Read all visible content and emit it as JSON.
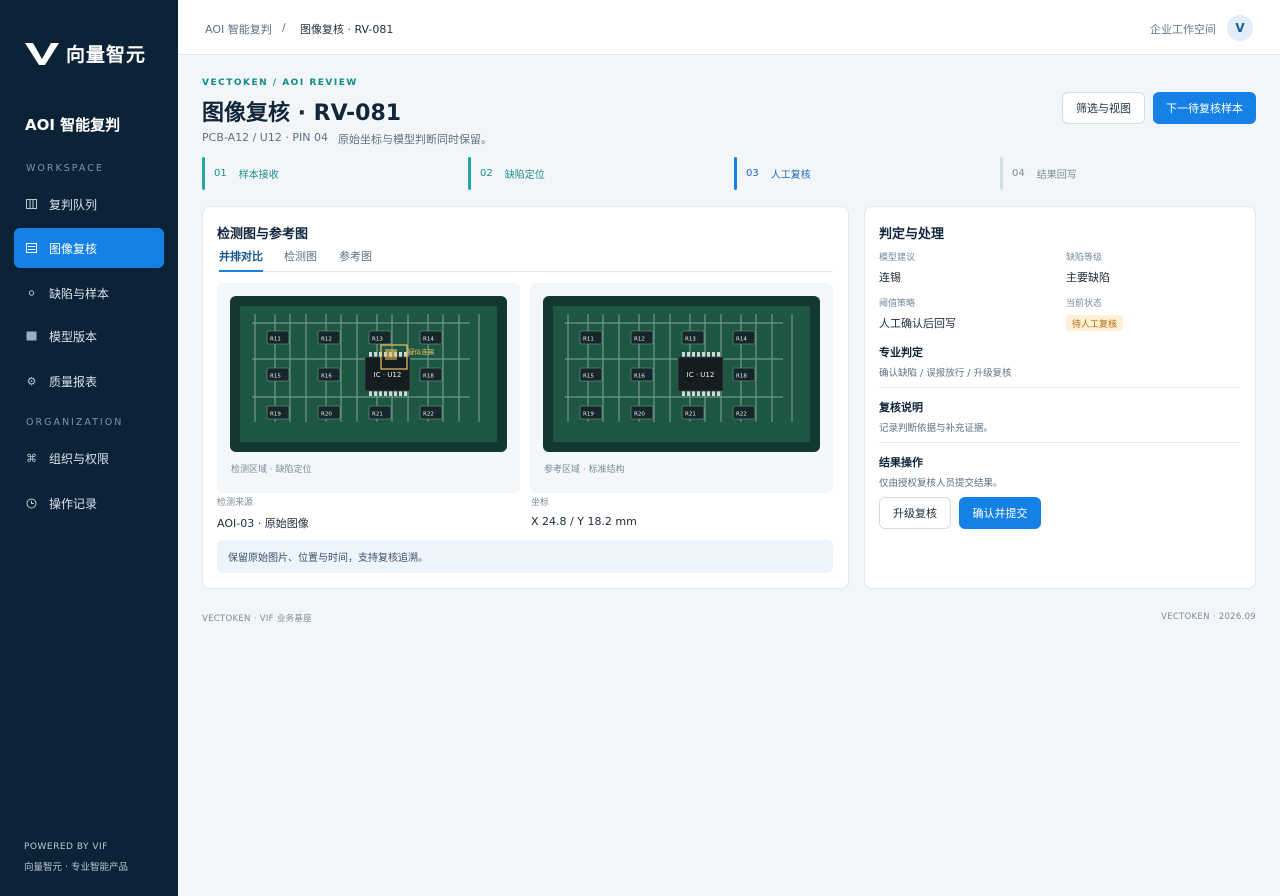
{
  "brand": {
    "logo_text": "向量智元",
    "app_title": "AOI 智能复判"
  },
  "sidebar": {
    "section_workspace": "WORKSPACE",
    "section_org": "ORGANIZATION",
    "items": [
      {
        "label": "复判队列",
        "icon": "columns-icon"
      },
      {
        "label": "图像复核",
        "icon": "list-icon"
      },
      {
        "label": "缺陷与样本",
        "icon": "dot-icon"
      },
      {
        "label": "模型版本",
        "icon": "grid-icon"
      },
      {
        "label": "质量报表",
        "icon": "gear-icon"
      },
      {
        "label": "组织与权限",
        "icon": "command-icon"
      },
      {
        "label": "操作记录",
        "icon": "clock-icon"
      }
    ],
    "powered": "POWERED BY VIF",
    "powered_sub": "向量智元 · 专业智能产品"
  },
  "topbar": {
    "breadcrumb_root": "AOI 智能复判",
    "breadcrumb_sep": "/",
    "breadcrumb_current": "图像复核 · RV-081",
    "workspace": "企业工作空间",
    "avatar": "V"
  },
  "header": {
    "eyebrow": "VECTOKEN / AOI REVIEW",
    "title": "图像复核 · RV-081",
    "subtitle": "PCB-A12 / U12 · PIN 04",
    "note": "原始坐标与模型判断同时保留。",
    "filter_button": "筛选与视图",
    "next_button": "下一待复核样本"
  },
  "steps": [
    {
      "num": "01",
      "label": "样本接收"
    },
    {
      "num": "02",
      "label": "缺陷定位"
    },
    {
      "num": "03",
      "label": "人工复核"
    },
    {
      "num": "04",
      "label": "结果回写"
    }
  ],
  "images_card": {
    "title": "检测图与参考图",
    "tabs": [
      "并排对比",
      "检测图",
      "参考图"
    ],
    "left_caption": "检测区域 · 缺陷定位",
    "right_caption": "参考区域 · 标准结构",
    "chip_label": "IC · U12",
    "defect_label": "疑似连锡",
    "resistors": [
      "R11",
      "R12",
      "R13",
      "R14",
      "R15",
      "R16",
      "R18",
      "R19",
      "R20",
      "R21",
      "R22"
    ],
    "source_label": "检测来源",
    "source_value": "AOI-03 · 原始图像",
    "coord_label": "坐标",
    "coord_value": "X 24.8 / Y 18.2 mm",
    "note": "保留原始图片、位置与时间，支持复核追溯。"
  },
  "decision_card": {
    "title": "判定与处理",
    "model_label": "模型建议",
    "model_value": "连锡",
    "level_label": "缺陷等级",
    "level_value": "主要缺陷",
    "threshold_label": "阈值策略",
    "threshold_value": "人工确认后回写",
    "status_label": "当前状态",
    "status_value": "待人工复核",
    "pro_title": "专业判定",
    "pro_desc": "确认缺陷 / 误报放行 / 升级复核",
    "review_title": "复核说明",
    "review_desc": "记录判断依据与补充证据。",
    "result_title": "结果操作",
    "result_desc": "仅由授权复核人员提交结果。",
    "escalate_button": "升级复核",
    "confirm_button": "确认并提交"
  },
  "footer": {
    "left": "VECTOKEN · VIF 业务基座",
    "right": "VECTOKEN · 2026.09"
  },
  "colors": {
    "sidebar_bg": "#0b2237",
    "primary": "#1580e6",
    "teal": "#22a89d",
    "pcb_frame": "#12382f",
    "pcb_board": "#1e5644",
    "defect": "#f0c060"
  }
}
